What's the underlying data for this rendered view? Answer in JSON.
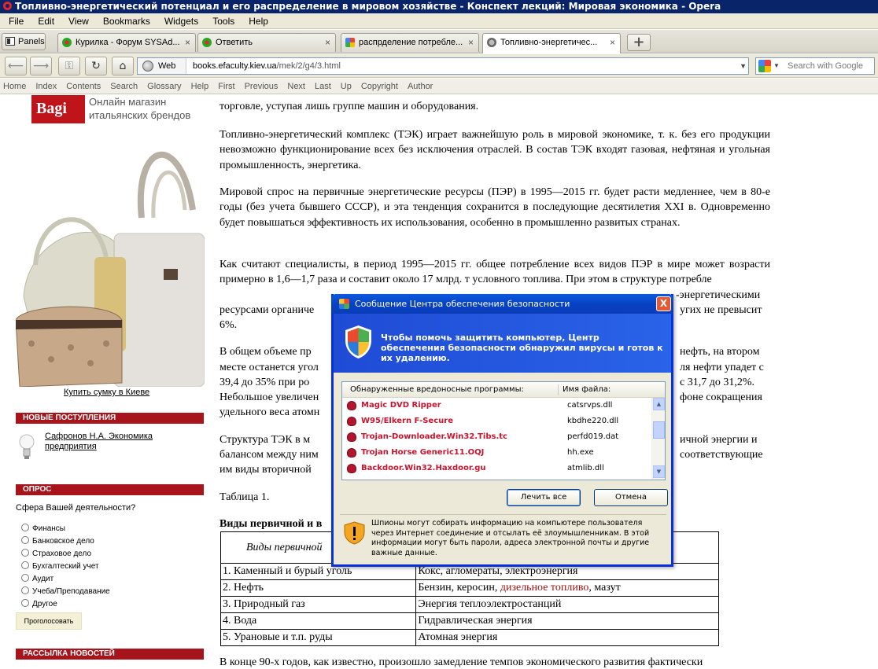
{
  "window": {
    "title": "Топливно-энергетический потенциал и его распределение в мировом хозяйстве - Конспект лекций: Мировая экономика - Opera"
  },
  "menu": [
    "File",
    "Edit",
    "View",
    "Bookmarks",
    "Widgets",
    "Tools",
    "Help"
  ],
  "tabs": {
    "panels_label": "Panels",
    "items": [
      {
        "label": "Курилка - Форум SYSAd...",
        "close": "×"
      },
      {
        "label": "Ответить",
        "close": "×"
      },
      {
        "label": "распрделение потребле...",
        "close": "×"
      },
      {
        "label": "Топливно-энергетичес...",
        "close": "×"
      }
    ],
    "new_tab": "+"
  },
  "address": {
    "zone_label": "Web",
    "url_host": "books.efaculty.kiev.ua",
    "url_path": "/mek/2/g4/3.html",
    "search_placeholder": "Search with Google"
  },
  "doc_nav": [
    "Home",
    "Index",
    "Contents",
    "Search",
    "Glossary",
    "Help",
    "First",
    "Previous",
    "Next",
    "Last",
    "Up",
    "Copyright",
    "Author"
  ],
  "sidebar": {
    "ad_logo": "Bagi",
    "ad_text_1": "Онлайн магазин",
    "ad_text_2": "итальянских брендов",
    "buy_link": "Купить сумку в Киеве",
    "new_header": "НОВЫЕ ПОСТУПЛЕНИЯ",
    "new_item": "Сафронов Н.А. Экономика предприятия",
    "poll_header": "ОПРОС",
    "poll_question": "Сфера Вашей деятельности?",
    "poll_options": [
      "Финансы",
      "Банковское дело",
      "Страховое дело",
      "Бухгалтеский учет",
      "Аудит",
      "Учеба/Преподавание",
      "Другое"
    ],
    "vote_button": "Проголосовать",
    "news_header": "РАССЫЛКА НОВОСТЕЙ"
  },
  "content": {
    "p0": "торговле, уступая лишь группе машин и оборудования.",
    "p1": "Топливно-энергетический комплекс (ТЭК) играет важнейшую роль в мировой экономике, т. к. без его продукции невозможно функционирование всех без исключения отраслей. В состав ТЭК входят газовая, нефтяная и угольная промышленность, энергетика.",
    "p2": "Мировой спрос на первичные энергетические ресурсы (ПЭР) в 1995—2015 гг. будет расти медленнее, чем в 80-е годы (без учета бывшего СССР), и эта тенденция сохранится в последующие десятилетия XXI в. Одновременно будет повышаться эффективность их использования, особенно в промышленно развитых странах.",
    "p3": "Как считают специалисты, в период 1995—2015 гг. общее потребление всех видов ПЭР в мире может возрасти примерно в 1,6—1,7 раза и составит около 17 млрд. т условного топлива. При этом в структуре потребле",
    "p3b": "-энергетическими",
    "p3c": "ресурсами органиче",
    "p3d": "угих не превысит",
    "p3e": "6%.",
    "p4a": "В общем объеме пр",
    "p4b": "нефть, на втором",
    "p4c": "месте останется угол",
    "p4d": "ля нефти упадет с",
    "p4e": "39,4 до 35% при ро",
    "p4f": "с 31,7 до 31,2%.",
    "p4g": "Небольшое увеличен",
    "p4h": "фоне сокращения",
    "p4i": "удельного веса атомн",
    "p5a": "Структура ТЭК в м",
    "p5b": "ичной энергии и",
    "p5c": "балансом между ним",
    "p5d": "соответствующие",
    "p5e": "им виды вторичной",
    "table_caption": "Таблица 1.",
    "table_title": "Виды первичной и в",
    "table_head": "Виды первичной",
    "rows": [
      {
        "a": "1. Каменный и бурый уголь",
        "b": "Кокс, агломераты, электроэнергия"
      },
      {
        "a": "2. Нефть",
        "b1": "Бензин, керосин, ",
        "b_link": "дизельное топливо",
        "b2": ", мазут"
      },
      {
        "a": "3. Природный газ",
        "b": "Энергия теплоэлектростанций"
      },
      {
        "a": "4. Вода",
        "b": "Гидравлическая энергия"
      },
      {
        "a": "5. Урановые и т.п. руды",
        "b": "Атомная энергия"
      }
    ],
    "p_last": "В конце 90-х годов, как известно, произошло замедление темпов экономического развития фактически"
  },
  "dialog": {
    "title": "Сообщение Центра обеспечения безопасности",
    "close": "X",
    "banner": "Чтобы помочь защитить компьютер, Центр обеспечения безопасности обнаружил вирусы и готов к их удалению.",
    "col_name": "Обнаруженные вредоносные программы:",
    "col_file": "Имя файла:",
    "threats": [
      {
        "name": "Magic DVD Ripper",
        "file": "catsrvps.dll"
      },
      {
        "name": "W95/Elkern F-Secure",
        "file": "kbdhe220.dll"
      },
      {
        "name": "Trojan-Downloader.Win32.Tibs.tc",
        "file": "perfd019.dat"
      },
      {
        "name": "Trojan Horse Generic11.OQJ",
        "file": "hh.exe"
      },
      {
        "name": "Backdoor.Win32.Haxdoor.gu",
        "file": "atmlib.dll"
      }
    ],
    "btn_heal": "Лечить все",
    "btn_cancel": "Отмена",
    "warning": "Шпионы могут собирать информацию на компьютере пользователя через Интернет соединение и отсылать её злоумышленникам. В этой информации могут быть пароли, адреса электронной почты и другие важные данные."
  }
}
